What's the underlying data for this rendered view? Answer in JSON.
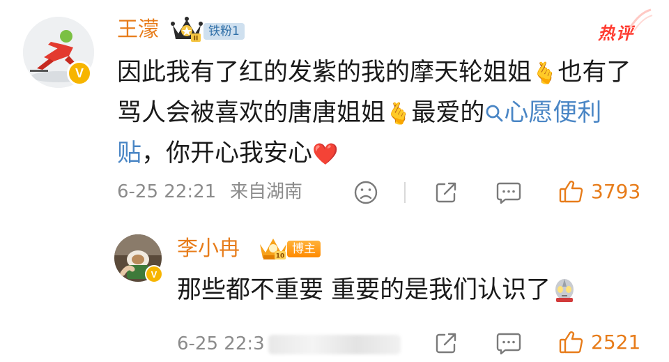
{
  "hot_tag": "热评",
  "comment": {
    "username": "王濛",
    "fan_badge": "铁粉1",
    "badge_level": "II",
    "verified_mark": "V",
    "text_part1": "因此我有了红的发紫的我的摩天轮姐姐",
    "emoji1": "🫰",
    "text_part2": "也有了骂人会被喜欢的唐唐姐姐",
    "emoji2": "🫰",
    "text_part3": "最爱的",
    "topic_icon": "search-icon",
    "topic_text": "心愿便利贴",
    "text_part4": "，你开心我安心",
    "emoji3": "❤️",
    "date": "6-25 22:21",
    "location": "来自湖南",
    "like_count": "3793"
  },
  "reply": {
    "username": "李小冉",
    "badge": "博主",
    "badge_level": "10",
    "verified_mark": "V",
    "text": "那些都不重要 重要的是我们认识了",
    "emoji": "ultraman-emoji",
    "date": "6-25 22:3",
    "like_count": "2521"
  },
  "colors": {
    "username": "#e77c1a",
    "topic_link": "#4a86c5",
    "like": "#e77c1a",
    "hot": "#ff3b30"
  }
}
